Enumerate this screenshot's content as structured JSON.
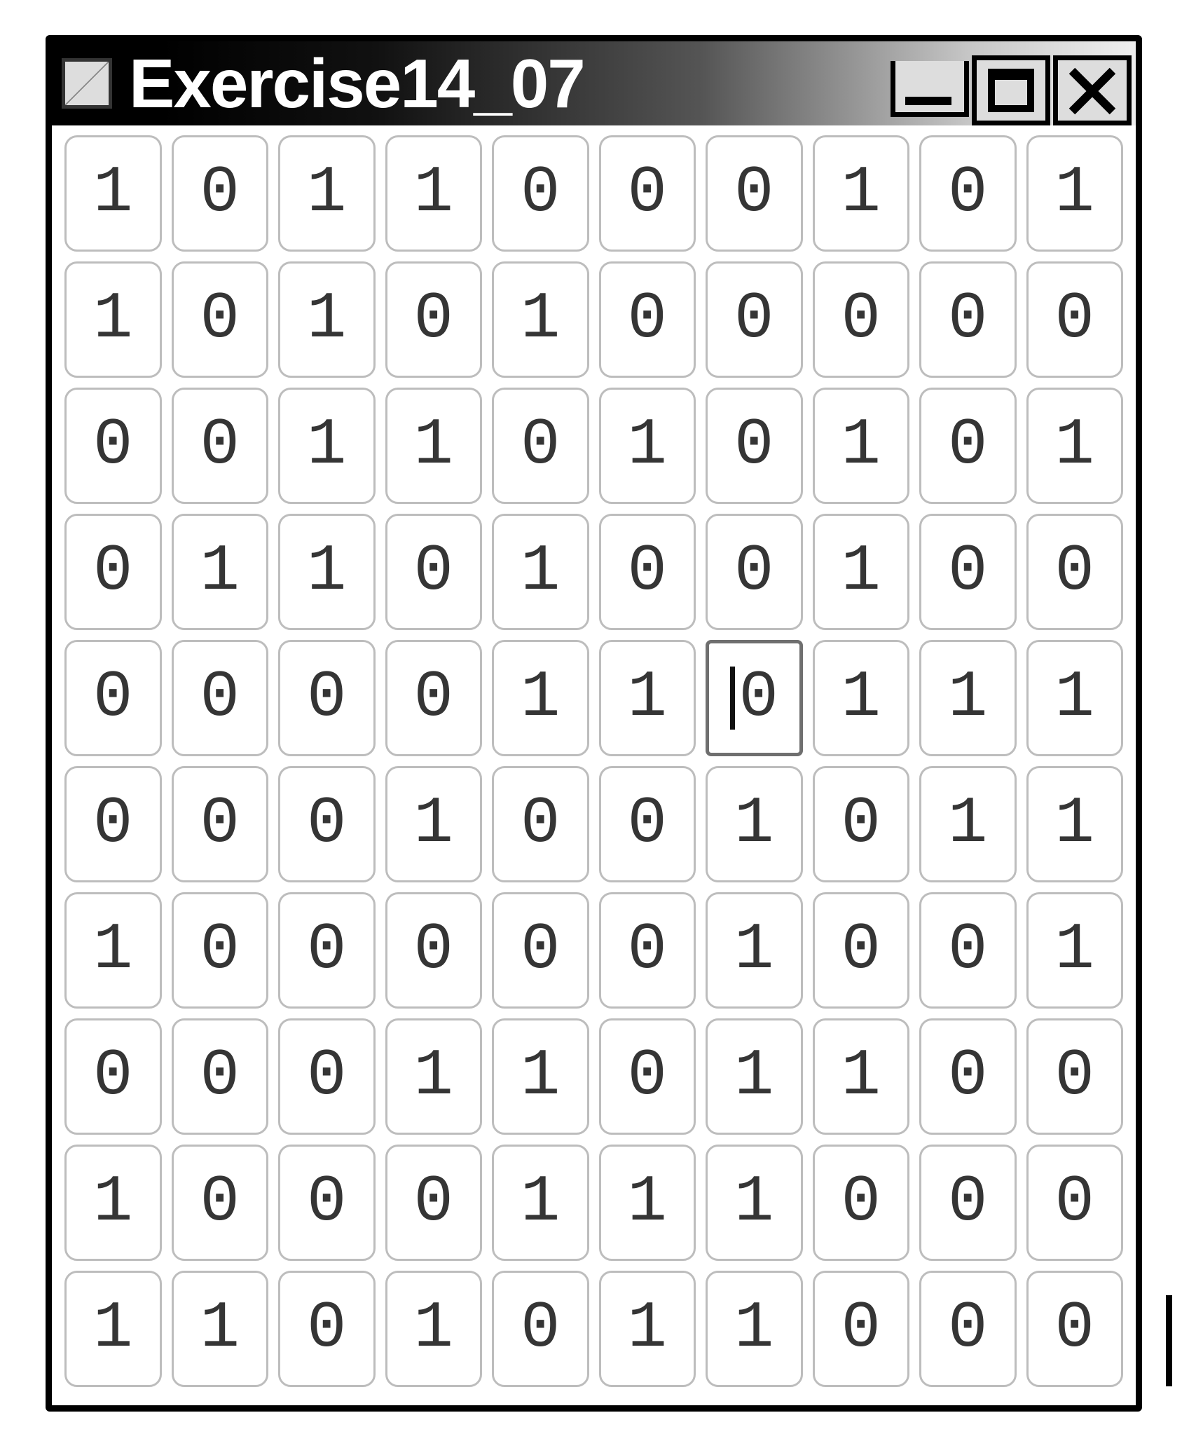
{
  "window": {
    "title": "Exercise14_07"
  },
  "grid": {
    "rows": 10,
    "cols": 10,
    "focused": {
      "row": 4,
      "col": 6
    },
    "cells": [
      [
        "1",
        "0",
        "1",
        "1",
        "0",
        "0",
        "0",
        "1",
        "0",
        "1"
      ],
      [
        "1",
        "0",
        "1",
        "0",
        "1",
        "0",
        "0",
        "0",
        "0",
        "0"
      ],
      [
        "0",
        "0",
        "1",
        "1",
        "0",
        "1",
        "0",
        "1",
        "0",
        "1"
      ],
      [
        "0",
        "1",
        "1",
        "0",
        "1",
        "0",
        "0",
        "1",
        "0",
        "0"
      ],
      [
        "0",
        "0",
        "0",
        "0",
        "1",
        "1",
        "0",
        "1",
        "1",
        "1"
      ],
      [
        "0",
        "0",
        "0",
        "1",
        "0",
        "0",
        "1",
        "0",
        "1",
        "1"
      ],
      [
        "1",
        "0",
        "0",
        "0",
        "0",
        "0",
        "1",
        "0",
        "0",
        "1"
      ],
      [
        "0",
        "0",
        "0",
        "1",
        "1",
        "0",
        "1",
        "1",
        "0",
        "0"
      ],
      [
        "1",
        "0",
        "0",
        "0",
        "1",
        "1",
        "1",
        "0",
        "0",
        "0"
      ],
      [
        "1",
        "1",
        "0",
        "1",
        "0",
        "1",
        "1",
        "0",
        "0",
        "0"
      ]
    ]
  }
}
